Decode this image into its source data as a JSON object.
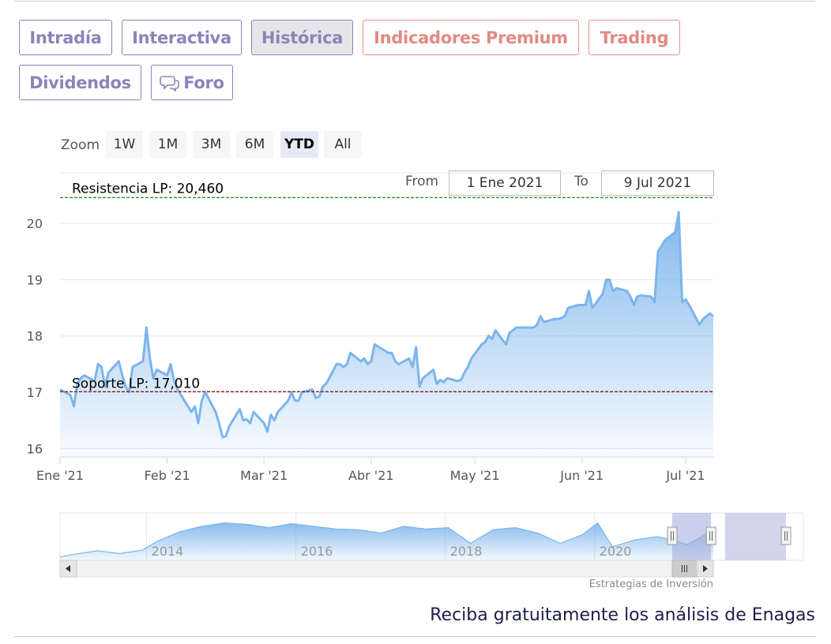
{
  "tabs": [
    {
      "label": "Intradía",
      "state": "normal"
    },
    {
      "label": "Interactiva",
      "state": "normal"
    },
    {
      "label": "Histórica",
      "state": "active"
    },
    {
      "label": "Indicadores Premium",
      "state": "premium"
    },
    {
      "label": "Trading",
      "state": "premium"
    },
    {
      "label": "Dividendos",
      "state": "normal"
    },
    {
      "label": "Foro",
      "state": "normal",
      "icon": "chat-bubbles-icon"
    }
  ],
  "zoom": {
    "label": "Zoom",
    "buttons": [
      "1W",
      "1M",
      "3M",
      "6M",
      "YTD",
      "All"
    ],
    "selected": "YTD"
  },
  "range": {
    "from_label": "From",
    "from_value": "1 Ene 2021",
    "to_label": "To",
    "to_value": "9 Jul 2021"
  },
  "credit": "Estrategias de Inversión",
  "cta": "Reciba gratuitamente los análisis de Enagas",
  "colors": {
    "accent": "#8b84b8",
    "premium": "#e28a83",
    "series": "#7cb5ec",
    "resistance": "#1d8a1d",
    "support": "#8b1a1a"
  },
  "chart_data": {
    "type": "area",
    "title": "",
    "xlabel": "",
    "ylabel": "",
    "ylim": [
      15.85,
      20.9
    ],
    "yticks": [
      16,
      17,
      18,
      19,
      20
    ],
    "x_range": [
      "2021-01-01",
      "2021-07-09"
    ],
    "x_ticks": [
      {
        "date": "2021-01-01",
        "label": "Ene '21"
      },
      {
        "date": "2021-02-01",
        "label": "Feb '21"
      },
      {
        "date": "2021-03-01",
        "label": "Mar '21"
      },
      {
        "date": "2021-04-01",
        "label": "Abr '21"
      },
      {
        "date": "2021-05-01",
        "label": "May '21"
      },
      {
        "date": "2021-06-01",
        "label": "Jun '21"
      },
      {
        "date": "2021-07-01",
        "label": "Jul '21"
      }
    ],
    "series": [
      {
        "name": "",
        "points": [
          [
            "2021-01-01",
            17.05
          ],
          [
            "2021-01-04",
            16.95
          ],
          [
            "2021-01-05",
            16.75
          ],
          [
            "2021-01-06",
            17.15
          ],
          [
            "2021-01-07",
            17.25
          ],
          [
            "2021-01-08",
            17.3
          ],
          [
            "2021-01-11",
            17.2
          ],
          [
            "2021-01-12",
            17.5
          ],
          [
            "2021-01-13",
            17.45
          ],
          [
            "2021-01-14",
            17.1
          ],
          [
            "2021-01-15",
            17.35
          ],
          [
            "2021-01-18",
            17.55
          ],
          [
            "2021-01-19",
            17.3
          ],
          [
            "2021-01-20",
            17.1
          ],
          [
            "2021-01-21",
            17.0
          ],
          [
            "2021-01-22",
            17.45
          ],
          [
            "2021-01-25",
            17.55
          ],
          [
            "2021-01-26",
            18.15
          ],
          [
            "2021-01-27",
            17.6
          ],
          [
            "2021-01-28",
            17.25
          ],
          [
            "2021-01-29",
            17.4
          ],
          [
            "2021-02-01",
            17.3
          ],
          [
            "2021-02-02",
            17.5
          ],
          [
            "2021-02-03",
            17.2
          ],
          [
            "2021-02-04",
            17.05
          ],
          [
            "2021-02-05",
            16.95
          ],
          [
            "2021-02-08",
            16.65
          ],
          [
            "2021-02-09",
            16.75
          ],
          [
            "2021-02-10",
            16.45
          ],
          [
            "2021-02-11",
            16.85
          ],
          [
            "2021-02-12",
            17.0
          ],
          [
            "2021-02-15",
            16.65
          ],
          [
            "2021-02-16",
            16.45
          ],
          [
            "2021-02-17",
            16.2
          ],
          [
            "2021-02-18",
            16.22
          ],
          [
            "2021-02-19",
            16.4
          ],
          [
            "2021-02-22",
            16.7
          ],
          [
            "2021-02-23",
            16.5
          ],
          [
            "2021-02-24",
            16.52
          ],
          [
            "2021-02-25",
            16.45
          ],
          [
            "2021-02-26",
            16.65
          ],
          [
            "2021-03-01",
            16.45
          ],
          [
            "2021-03-02",
            16.3
          ],
          [
            "2021-03-03",
            16.6
          ],
          [
            "2021-03-04",
            16.5
          ],
          [
            "2021-03-05",
            16.65
          ],
          [
            "2021-03-08",
            16.85
          ],
          [
            "2021-03-09",
            17.0
          ],
          [
            "2021-03-10",
            16.85
          ],
          [
            "2021-03-11",
            16.85
          ],
          [
            "2021-03-12",
            17.0
          ],
          [
            "2021-03-15",
            17.05
          ],
          [
            "2021-03-16",
            16.9
          ],
          [
            "2021-03-17",
            16.92
          ],
          [
            "2021-03-18",
            17.1
          ],
          [
            "2021-03-19",
            17.15
          ],
          [
            "2021-03-22",
            17.5
          ],
          [
            "2021-03-23",
            17.5
          ],
          [
            "2021-03-24",
            17.45
          ],
          [
            "2021-03-25",
            17.5
          ],
          [
            "2021-03-26",
            17.7
          ],
          [
            "2021-03-29",
            17.55
          ],
          [
            "2021-03-30",
            17.6
          ],
          [
            "2021-03-31",
            17.5
          ],
          [
            "2021-04-01",
            17.55
          ],
          [
            "2021-04-02",
            17.85
          ],
          [
            "2021-04-06",
            17.7
          ],
          [
            "2021-04-07",
            17.7
          ],
          [
            "2021-04-08",
            17.55
          ],
          [
            "2021-04-09",
            17.5
          ],
          [
            "2021-04-12",
            17.6
          ],
          [
            "2021-04-13",
            17.45
          ],
          [
            "2021-04-14",
            17.8
          ],
          [
            "2021-04-15",
            17.1
          ],
          [
            "2021-04-16",
            17.25
          ],
          [
            "2021-04-19",
            17.4
          ],
          [
            "2021-04-20",
            17.15
          ],
          [
            "2021-04-21",
            17.22
          ],
          [
            "2021-04-22",
            17.18
          ],
          [
            "2021-04-23",
            17.25
          ],
          [
            "2021-04-26",
            17.2
          ],
          [
            "2021-04-27",
            17.22
          ],
          [
            "2021-04-28",
            17.35
          ],
          [
            "2021-04-29",
            17.45
          ],
          [
            "2021-04-30",
            17.6
          ],
          [
            "2021-05-03",
            17.85
          ],
          [
            "2021-05-04",
            17.9
          ],
          [
            "2021-05-05",
            18.0
          ],
          [
            "2021-05-06",
            17.95
          ],
          [
            "2021-05-07",
            18.1
          ],
          [
            "2021-05-10",
            17.85
          ],
          [
            "2021-05-11",
            18.05
          ],
          [
            "2021-05-12",
            18.1
          ],
          [
            "2021-05-13",
            18.15
          ],
          [
            "2021-05-14",
            18.15
          ],
          [
            "2021-05-17",
            18.15
          ],
          [
            "2021-05-18",
            18.15
          ],
          [
            "2021-05-19",
            18.2
          ],
          [
            "2021-05-20",
            18.35
          ],
          [
            "2021-05-21",
            18.25
          ],
          [
            "2021-05-24",
            18.3
          ],
          [
            "2021-05-25",
            18.3
          ],
          [
            "2021-05-26",
            18.32
          ],
          [
            "2021-05-27",
            18.35
          ],
          [
            "2021-05-28",
            18.5
          ],
          [
            "2021-05-31",
            18.55
          ],
          [
            "2021-06-01",
            18.55
          ],
          [
            "2021-06-02",
            18.55
          ],
          [
            "2021-06-03",
            18.8
          ],
          [
            "2021-06-04",
            18.5
          ],
          [
            "2021-06-07",
            18.75
          ],
          [
            "2021-06-08",
            19.0
          ],
          [
            "2021-06-09",
            19.0
          ],
          [
            "2021-06-10",
            18.8
          ],
          [
            "2021-06-11",
            18.85
          ],
          [
            "2021-06-14",
            18.8
          ],
          [
            "2021-06-15",
            18.7
          ],
          [
            "2021-06-16",
            18.55
          ],
          [
            "2021-06-17",
            18.7
          ],
          [
            "2021-06-18",
            18.72
          ],
          [
            "2021-06-21",
            18.7
          ],
          [
            "2021-06-22",
            18.6
          ],
          [
            "2021-06-23",
            19.5
          ],
          [
            "2021-06-24",
            19.6
          ],
          [
            "2021-06-25",
            19.7
          ],
          [
            "2021-06-28",
            19.85
          ],
          [
            "2021-06-29",
            20.2
          ],
          [
            "2021-06-30",
            18.6
          ],
          [
            "2021-07-01",
            18.65
          ],
          [
            "2021-07-02",
            18.55
          ],
          [
            "2021-07-05",
            18.2
          ],
          [
            "2021-07-06",
            18.3
          ],
          [
            "2021-07-07",
            18.35
          ],
          [
            "2021-07-08",
            18.4
          ],
          [
            "2021-07-09",
            18.35
          ]
        ]
      }
    ],
    "annotations": [
      {
        "label": "Resistencia LP: 20,460",
        "value": 20.46,
        "color": "#1d8a1d"
      },
      {
        "label": "Soporte LP: 17,010",
        "value": 17.01,
        "color": "#8b1a1a"
      }
    ],
    "navigator": {
      "x_tick_labels": [
        "2014",
        "2016",
        "2018",
        "2020"
      ],
      "x_tick_years": [
        2014,
        2016,
        2018,
        2020
      ],
      "x_range_years": [
        2012.8,
        2021.55
      ],
      "selection_years": [
        2021.0,
        2021.52
      ],
      "points": [
        [
          2012.8,
          14.5
        ],
        [
          2013.0,
          14.9
        ],
        [
          2013.3,
          15.4
        ],
        [
          2013.6,
          15.0
        ],
        [
          2013.9,
          15.5
        ],
        [
          2014.1,
          16.8
        ],
        [
          2014.4,
          18.2
        ],
        [
          2014.7,
          19.0
        ],
        [
          2015.0,
          19.5
        ],
        [
          2015.3,
          19.3
        ],
        [
          2015.6,
          18.8
        ],
        [
          2015.9,
          19.4
        ],
        [
          2016.2,
          19.0
        ],
        [
          2016.5,
          18.6
        ],
        [
          2016.8,
          18.5
        ],
        [
          2017.1,
          18.0
        ],
        [
          2017.4,
          19.0
        ],
        [
          2017.7,
          18.6
        ],
        [
          2018.0,
          18.8
        ],
        [
          2018.3,
          16.5
        ],
        [
          2018.6,
          18.5
        ],
        [
          2018.9,
          18.8
        ],
        [
          2019.2,
          18.0
        ],
        [
          2019.5,
          16.5
        ],
        [
          2019.8,
          17.8
        ],
        [
          2020.0,
          19.5
        ],
        [
          2020.2,
          16.0
        ],
        [
          2020.5,
          17.0
        ],
        [
          2020.8,
          17.5
        ],
        [
          2021.0,
          17.0
        ],
        [
          2021.2,
          16.3
        ],
        [
          2021.4,
          17.5
        ],
        [
          2021.5,
          18.2
        ],
        [
          2021.55,
          18.3
        ]
      ]
    }
  }
}
